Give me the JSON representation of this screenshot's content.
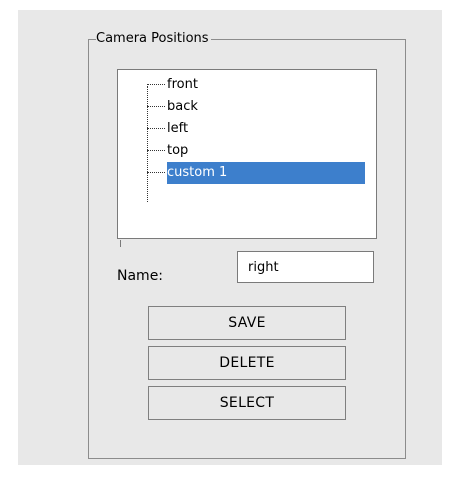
{
  "group": {
    "title": "Camera Positions"
  },
  "tree": {
    "items": [
      {
        "label": "front",
        "selected": false
      },
      {
        "label": "back",
        "selected": false
      },
      {
        "label": "left",
        "selected": false
      },
      {
        "label": "top",
        "selected": false
      },
      {
        "label": "custom 1",
        "selected": true
      }
    ]
  },
  "name_field": {
    "label": "Name:",
    "value": "right"
  },
  "buttons": {
    "save": "SAVE",
    "delete": "DELETE",
    "select": "SELECT"
  },
  "colors": {
    "selection": "#3d7fcc",
    "panel": "#e8e8e8"
  }
}
